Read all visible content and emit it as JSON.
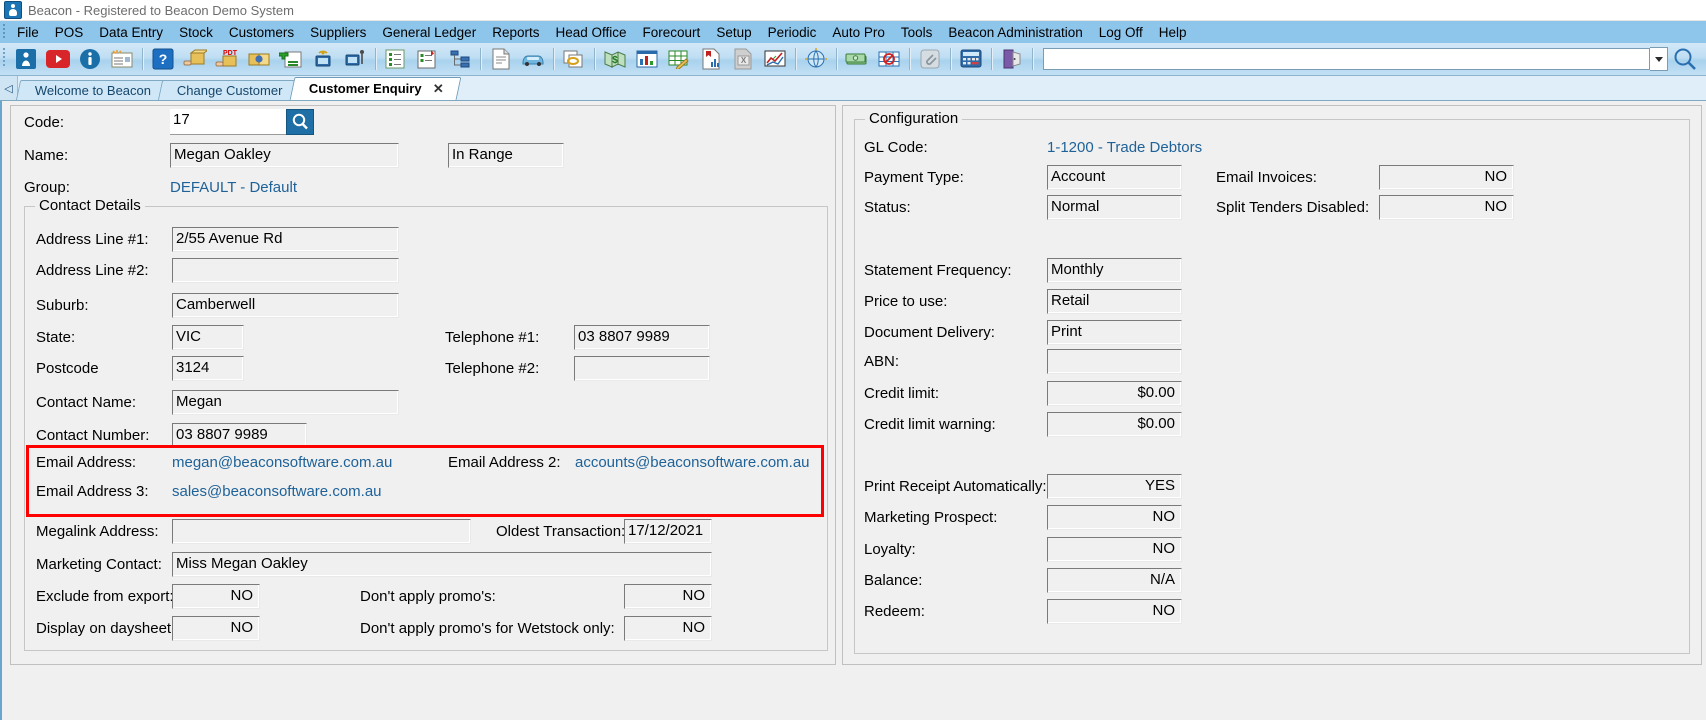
{
  "window": {
    "title": "Beacon - Registered to Beacon Demo System",
    "app_icon": "beacon-icon"
  },
  "menubar": {
    "items": [
      "File",
      "POS",
      "Data Entry",
      "Stock",
      "Customers",
      "Suppliers",
      "General Ledger",
      "Reports",
      "Head Office",
      "Forecourt",
      "Setup",
      "Periodic",
      "Auto Pro",
      "Tools",
      "Beacon Administration",
      "Log Off",
      "Help"
    ]
  },
  "toolbar": {
    "buttons": [
      {
        "name": "beacon-home-icon",
        "glyph": "person"
      },
      {
        "name": "youtube-icon",
        "glyph": "youtube"
      },
      {
        "name": "info-icon",
        "glyph": "info"
      },
      {
        "name": "news-letter-icon",
        "glyph": "envelope"
      },
      {
        "name": "help-icon",
        "glyph": "question"
      },
      {
        "name": "goods-receive-icon",
        "glyph": "box-hand"
      },
      {
        "name": "pdt-icon",
        "glyph": "pdt"
      },
      {
        "name": "stock-transfer-icon",
        "glyph": "boxes"
      },
      {
        "name": "add-order-icon",
        "glyph": "add-list"
      },
      {
        "name": "wireless-terminal-icon",
        "glyph": "monitor-wifi"
      },
      {
        "name": "usb-terminal-icon",
        "glyph": "monitor-usb"
      },
      {
        "name": "stock-list-icon",
        "glyph": "list-green"
      },
      {
        "name": "checklist-icon",
        "glyph": "clipboard-flag"
      },
      {
        "name": "tree-view-icon",
        "glyph": "hierarchy"
      },
      {
        "name": "document-icon",
        "glyph": "document"
      },
      {
        "name": "vehicle-icon",
        "glyph": "car"
      },
      {
        "name": "linked-documents-icon",
        "glyph": "link-docs"
      },
      {
        "name": "money-map-icon",
        "glyph": "money-map"
      },
      {
        "name": "chart-icon",
        "glyph": "bar-chart"
      },
      {
        "name": "spreadsheet-edit-icon",
        "glyph": "grid-pencil"
      },
      {
        "name": "report-icon",
        "glyph": "report"
      },
      {
        "name": "excel-export-icon",
        "glyph": "excel"
      },
      {
        "name": "analysis-icon",
        "glyph": "analysis"
      },
      {
        "name": "globe-icon",
        "glyph": "globe"
      },
      {
        "name": "cash-icon",
        "glyph": "cash"
      },
      {
        "name": "no-grid-icon",
        "glyph": "grid-no"
      },
      {
        "name": "attachment-icon",
        "glyph": "attach"
      },
      {
        "name": "calculator-icon",
        "glyph": "calculator"
      },
      {
        "name": "exit-door-icon",
        "glyph": "door"
      }
    ],
    "search_value": "",
    "search_placeholder": "",
    "magnifier_icon": "search-icon",
    "dropdown_icon": "chevron-down-icon"
  },
  "tabs": {
    "nav_icon": "prev-tab-icon",
    "items": [
      {
        "label": "Welcome to Beacon",
        "active": false,
        "closable": false
      },
      {
        "label": "Change Customer",
        "active": false,
        "closable": false
      },
      {
        "label": "Customer Enquiry",
        "active": true,
        "closable": true,
        "close_label": "✕"
      }
    ]
  },
  "form": {
    "code": {
      "label": "Code:",
      "value": "17",
      "search_icon": "magnifier-icon"
    },
    "name": {
      "label": "Name:",
      "value": "Megan Oakley"
    },
    "range_status": {
      "value": "In Range"
    },
    "group": {
      "label": "Group:",
      "value": "DEFAULT - Default"
    },
    "contact_details": {
      "title": "Contact Details",
      "fields": [
        {
          "label": "Address Line #1:",
          "value": "2/55 Avenue Rd"
        },
        {
          "label": "Address Line #2:",
          "value": ""
        },
        {
          "label": "Suburb:",
          "value": "Camberwell"
        },
        {
          "label": "State:",
          "value": "VIC"
        },
        {
          "label": "Postcode",
          "value": "3124"
        },
        {
          "label": "Contact Name:",
          "value": "Megan"
        },
        {
          "label": "Contact Number:",
          "value": "03 8807 9989"
        }
      ],
      "telephone1": {
        "label": "Telephone #1:",
        "value": "03 8807 9989"
      },
      "telephone2": {
        "label": "Telephone #2:",
        "value": ""
      },
      "email1": {
        "label": "Email Address:",
        "value": "megan@beaconsoftware.com.au"
      },
      "email2": {
        "label": "Email Address 2:",
        "value": "accounts@beaconsoftware.com.au"
      },
      "email3": {
        "label": "Email Address 3:",
        "value": "sales@beaconsoftware.com.au"
      },
      "megalink": {
        "label": "Megalink Address:",
        "value": ""
      },
      "oldest_transaction": {
        "label": "Oldest Transaction:",
        "value": "17/12/2021"
      },
      "marketing_contact": {
        "label": "Marketing Contact:",
        "value": "Miss Megan Oakley"
      },
      "exclude_from_export": {
        "label": "Exclude from export:",
        "value": "NO"
      },
      "dont_apply_promos": {
        "label": "Don't apply promo's:",
        "value": "NO"
      },
      "display_on_daysheet": {
        "label": "Display on daysheet:",
        "value": "NO"
      },
      "dont_apply_promos_wetstock": {
        "label": "Don't apply promo's for Wetstock only:",
        "value": "NO"
      }
    },
    "configuration": {
      "title": "Configuration",
      "gl_code": {
        "label": "GL Code:",
        "value": "1-1200 - Trade Debtors"
      },
      "payment_type": {
        "label": "Payment Type:",
        "value": "Account"
      },
      "status": {
        "label": "Status:",
        "value": "Normal"
      },
      "email_invoices": {
        "label": "Email Invoices:",
        "value": "NO"
      },
      "split_tenders_disabled": {
        "label": "Split Tenders Disabled:",
        "value": "NO"
      },
      "statement_frequency": {
        "label": "Statement Frequency:",
        "value": "Monthly"
      },
      "price_to_use": {
        "label": "Price to use:",
        "value": "Retail"
      },
      "document_delivery": {
        "label": "Document Delivery:",
        "value": "Print"
      },
      "abn": {
        "label": "ABN:",
        "value": ""
      },
      "credit_limit": {
        "label": "Credit limit:",
        "value": "$0.00"
      },
      "credit_limit_warning": {
        "label": "Credit limit warning:",
        "value": "$0.00"
      },
      "print_receipt_automatically": {
        "label": "Print Receipt Automatically:",
        "value": "YES"
      },
      "marketing_prospect": {
        "label": "Marketing Prospect:",
        "value": "NO"
      },
      "loyalty": {
        "label": "Loyalty:",
        "value": "NO"
      },
      "balance": {
        "label": "Balance:",
        "value": "N/A"
      },
      "redeem": {
        "label": "Redeem:",
        "value": "NO"
      }
    }
  },
  "colors": {
    "menu_bg": "#8ec5eb",
    "link_blue": "#1f6298",
    "highlight_red": "#ff0000",
    "form_bg": "#f0f0f0"
  }
}
